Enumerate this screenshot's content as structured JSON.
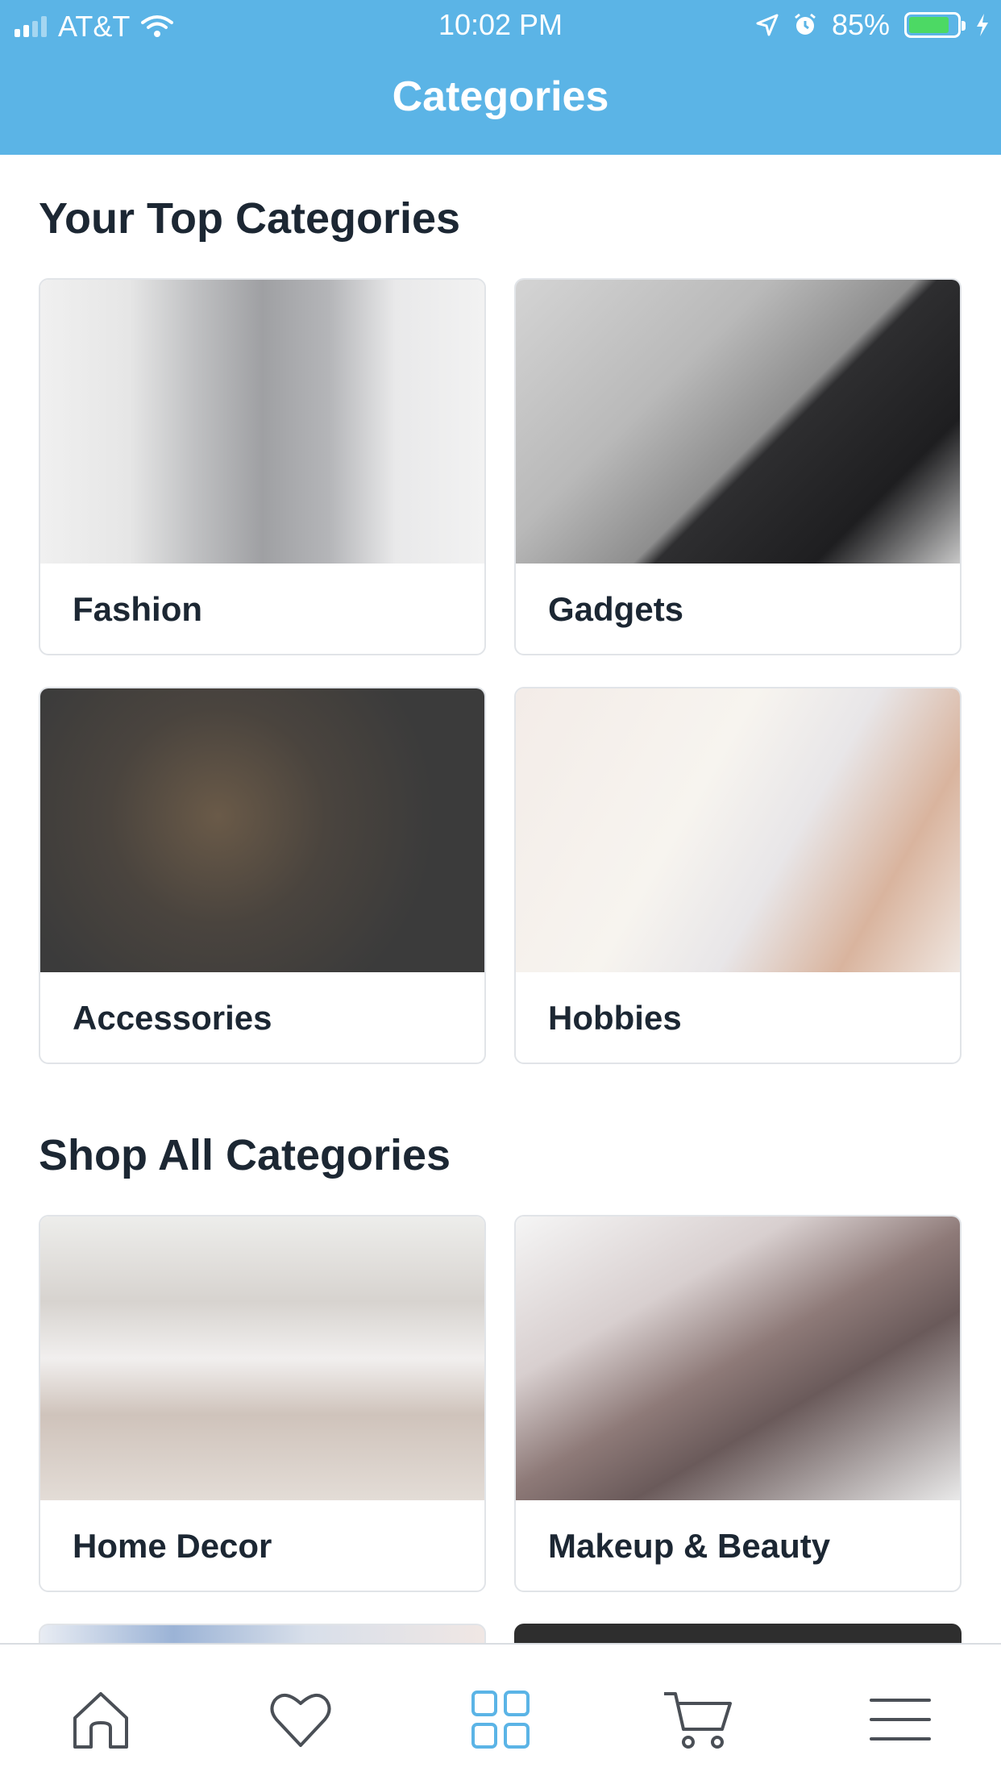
{
  "status_bar": {
    "carrier": "AT&T",
    "time": "10:02 PM",
    "battery": "85%",
    "battery_level": 0.85
  },
  "header": {
    "title": "Categories"
  },
  "top_categories": {
    "title": "Your Top Categories",
    "items": [
      {
        "label": "Fashion"
      },
      {
        "label": "Gadgets"
      },
      {
        "label": "Accessories"
      },
      {
        "label": "Hobbies"
      }
    ]
  },
  "all_categories": {
    "title": "Shop All Categories",
    "items": [
      {
        "label": "Home Decor"
      },
      {
        "label": "Makeup & Beauty"
      }
    ]
  },
  "tabbar": {
    "tabs": [
      {
        "icon": "home-icon",
        "active": false
      },
      {
        "icon": "heart-icon",
        "active": false
      },
      {
        "icon": "grid-icon",
        "active": true
      },
      {
        "icon": "cart-icon",
        "active": false
      },
      {
        "icon": "menu-icon",
        "active": false
      }
    ],
    "active_color": "#5bb4e6",
    "inactive_color": "#4a4f56"
  },
  "colors": {
    "brand": "#5bb4e6",
    "battery_fill": "#4cd964"
  }
}
